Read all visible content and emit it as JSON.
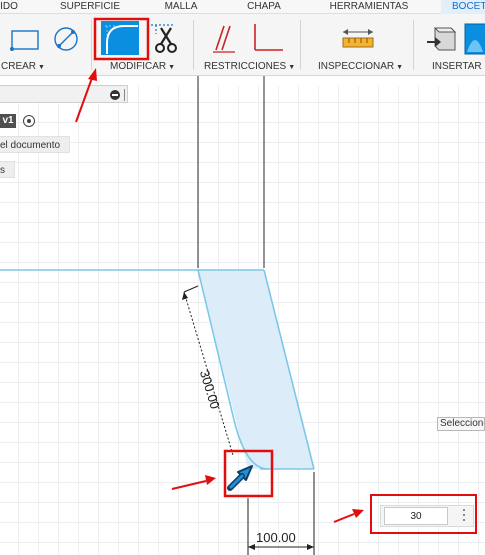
{
  "tabs": [
    {
      "label": "IDO",
      "active": false
    },
    {
      "label": "SUPERFICIE",
      "active": false
    },
    {
      "label": "MALLA",
      "active": false
    },
    {
      "label": "CHAPA",
      "active": false
    },
    {
      "label": "HERRAMIENTAS",
      "active": false
    },
    {
      "label": "BOCETO",
      "active": true
    }
  ],
  "toolbar": {
    "groups": [
      {
        "label": "CREAR"
      },
      {
        "label": "MODIFICAR"
      },
      {
        "label": "RESTRICCIONES"
      },
      {
        "label": "INSPECCIONAR"
      },
      {
        "label": "INSERTAR"
      }
    ],
    "icons": [
      "rectangle-icon",
      "circle-diameter-icon",
      "fillet-icon",
      "trim-scissors-icon",
      "parallel-constraint-icon",
      "perpendicular-constraint-icon",
      "measure-icon",
      "insert-derive-icon",
      "insert-canvas-icon"
    ]
  },
  "browser": {
    "version_tag": "v1",
    "node_document": "el documento",
    "node_short": "s"
  },
  "canvas": {
    "dimension_angled": "300.00",
    "dimension_bottom": "100.00",
    "tooltip": "Seleccione"
  },
  "fillet_input": {
    "value": "30"
  },
  "colors": {
    "accent_blue": "#0a8ee0",
    "highlight_red": "#e20e0e",
    "sketch_line": "#7cc8e8",
    "profile_fill": "#dcedf9"
  }
}
